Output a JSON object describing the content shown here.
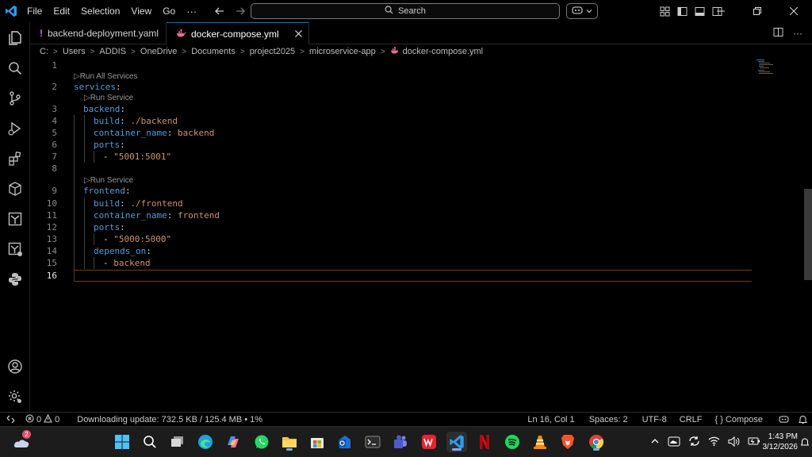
{
  "titlebar": {
    "menu": [
      "File",
      "Edit",
      "Selection",
      "View",
      "Go"
    ],
    "more": "···",
    "search_label": "Search"
  },
  "tabs": [
    {
      "label": "backend-deployment.yaml",
      "icon": "exclamation-icon",
      "active": false
    },
    {
      "label": "docker-compose.yml",
      "icon": "docker-whale-icon",
      "active": true
    }
  ],
  "breadcrumb": [
    "C:",
    "Users",
    "ADDIS",
    "OneDrive",
    "Documents",
    "project2025",
    "microservice-app",
    "docker-compose.yml"
  ],
  "codelens": {
    "run_all": "Run All Services",
    "run_service": "Run Service"
  },
  "editor": {
    "line_numbers": [
      "1",
      "2",
      "3",
      "4",
      "5",
      "6",
      "7",
      "8",
      "9",
      "10",
      "11",
      "12",
      "13",
      "14",
      "15",
      "16"
    ],
    "lines": {
      "l2_key": "services",
      "l3_key": "backend",
      "l4_key": "build",
      "l4_val": "./backend",
      "l5_key": "container_name",
      "l5_val": "backend",
      "l6_key": "ports",
      "l7_val": "\"5001:5001\"",
      "l9_key": "frontend",
      "l10_key": "build",
      "l10_val": "./frontend",
      "l11_key": "container_name",
      "l11_val": "frontend",
      "l12_key": "ports",
      "l13_val": "\"5000:5000\"",
      "l14_key": "depends_on",
      "l15_val": "backend"
    }
  },
  "statusbar": {
    "errors": "0",
    "warnings": "0",
    "download": "Downloading update: 732.5 KB / 125.4 MB • 1%",
    "position": "Ln 16, Col 1",
    "spaces": "Spaces: 2",
    "encoding": "UTF-8",
    "eol": "CRLF",
    "braces": "{ }",
    "language": "Compose"
  },
  "taskbar": {
    "weather_badge": "2",
    "time": "1:43 PM",
    "date": "3/12/2026"
  },
  "colors": {
    "key": "#569cd6",
    "string": "#ce9178",
    "accent": "#0078d4",
    "current_line": "#7a3a10"
  }
}
